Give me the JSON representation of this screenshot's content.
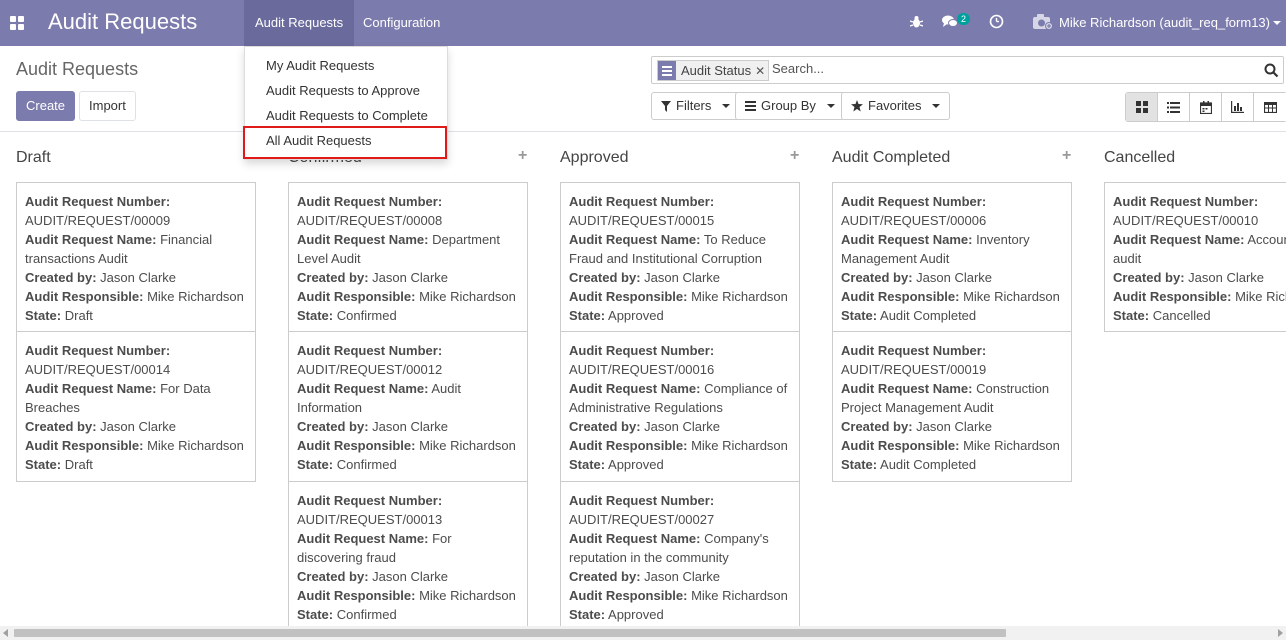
{
  "navbar": {
    "brand": "Audit Requests",
    "menus": [
      "Audit Requests",
      "Configuration"
    ],
    "message_count": "2",
    "user": "Mike Richardson (audit_req_form13)",
    "bg_color": "#7c7bad"
  },
  "dropdown": {
    "items": [
      "My Audit Requests",
      "Audit Requests to Approve",
      "Audit Requests to Complete",
      "All Audit Requests"
    ]
  },
  "control_panel": {
    "title": "Audit Requests",
    "create_label": "Create",
    "import_label": "Import",
    "facet_label": "Audit Status",
    "search_placeholder": "Search...",
    "filters_label": "Filters",
    "groupby_label": "Group By",
    "favorites_label": "Favorites",
    "views": [
      "kanban",
      "list",
      "calendar",
      "graph",
      "pivot"
    ]
  },
  "labels": {
    "number": "Audit Request Number:",
    "name": "Audit Request Name:",
    "created_by": "Created by:",
    "responsible": "Audit Responsible:",
    "state": "State:"
  },
  "columns": [
    {
      "title": "Draft",
      "cards": [
        {
          "number": "AUDIT/REQUEST/00009",
          "name": "Financial transactions Audit",
          "created_by": "Jason Clarke",
          "responsible": "Mike Richardson",
          "state": "Draft"
        },
        {
          "number": "AUDIT/REQUEST/00014",
          "name": "For Data Breaches",
          "created_by": "Jason Clarke",
          "responsible": "Mike Richardson",
          "state": "Draft"
        }
      ]
    },
    {
      "title": "Confirmed",
      "cards": [
        {
          "number": "AUDIT/REQUEST/00008",
          "name": "Department Level Audit",
          "created_by": "Jason Clarke",
          "responsible": "Mike Richardson",
          "state": "Confirmed"
        },
        {
          "number": "AUDIT/REQUEST/00012",
          "name": "Audit Information",
          "created_by": "Jason Clarke",
          "responsible": "Mike Richardson",
          "state": "Confirmed"
        },
        {
          "number": "AUDIT/REQUEST/00013",
          "name": "For discovering fraud",
          "created_by": "Jason Clarke",
          "responsible": "Mike Richardson",
          "state": "Confirmed"
        }
      ]
    },
    {
      "title": "Approved",
      "cards": [
        {
          "number": "AUDIT/REQUEST/00015",
          "name": "To Reduce Fraud and Institutional Corruption",
          "created_by": "Jason Clarke",
          "responsible": "Mike Richardson",
          "state": "Approved"
        },
        {
          "number": "AUDIT/REQUEST/00016",
          "name": "Compliance of Administrative Regulations",
          "created_by": "Jason Clarke",
          "responsible": "Mike Richardson",
          "state": "Approved"
        },
        {
          "number": "AUDIT/REQUEST/00027",
          "name": "Company's reputation in the community",
          "created_by": "Jason Clarke",
          "responsible": "Mike Richardson",
          "state": "Approved"
        }
      ]
    },
    {
      "title": "Audit Completed",
      "cards": [
        {
          "number": "AUDIT/REQUEST/00006",
          "name": "Inventory Management Audit",
          "created_by": "Jason Clarke",
          "responsible": "Mike Richardson",
          "state": "Audit Completed"
        },
        {
          "number": "AUDIT/REQUEST/00019",
          "name": "Construction Project Management Audit",
          "created_by": "Jason Clarke",
          "responsible": "Mike Richardson",
          "state": "Audit Completed"
        }
      ]
    },
    {
      "title": "Cancelled",
      "cards": [
        {
          "number": "AUDIT/REQUEST/00010",
          "name": "Accounting audit",
          "created_by": "Jason Clarke",
          "responsible": "Mike Richardson",
          "state": "Cancelled"
        }
      ]
    }
  ]
}
